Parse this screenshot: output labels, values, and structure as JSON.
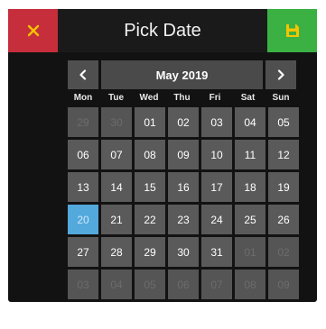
{
  "header": {
    "title": "Pick Date",
    "close_icon": "x-icon",
    "save_icon": "floppy-disk-icon",
    "close_color": "#c62e3c",
    "save_color": "#3bb043"
  },
  "nav": {
    "prev": "<",
    "next": ">",
    "month_label": "May 2019"
  },
  "weekdays": [
    "Mon",
    "Tue",
    "Wed",
    "Thu",
    "Fri",
    "Sat",
    "Sun"
  ],
  "days": [
    {
      "label": "29",
      "muted": true
    },
    {
      "label": "30",
      "muted": true
    },
    {
      "label": "01"
    },
    {
      "label": "02"
    },
    {
      "label": "03"
    },
    {
      "label": "04"
    },
    {
      "label": "05"
    },
    {
      "label": "06"
    },
    {
      "label": "07"
    },
    {
      "label": "08"
    },
    {
      "label": "09"
    },
    {
      "label": "10"
    },
    {
      "label": "11"
    },
    {
      "label": "12"
    },
    {
      "label": "13"
    },
    {
      "label": "14"
    },
    {
      "label": "15"
    },
    {
      "label": "16"
    },
    {
      "label": "17"
    },
    {
      "label": "18"
    },
    {
      "label": "19"
    },
    {
      "label": "20",
      "selected": true
    },
    {
      "label": "21"
    },
    {
      "label": "22"
    },
    {
      "label": "23"
    },
    {
      "label": "24"
    },
    {
      "label": "25"
    },
    {
      "label": "26"
    },
    {
      "label": "27"
    },
    {
      "label": "28"
    },
    {
      "label": "29"
    },
    {
      "label": "30"
    },
    {
      "label": "31"
    },
    {
      "label": "01",
      "muted": true
    },
    {
      "label": "02",
      "muted": true
    },
    {
      "label": "03",
      "muted": true
    },
    {
      "label": "04",
      "muted": true
    },
    {
      "label": "05",
      "muted": true
    },
    {
      "label": "06",
      "muted": true
    },
    {
      "label": "07",
      "muted": true
    },
    {
      "label": "08",
      "muted": true
    },
    {
      "label": "09",
      "muted": true
    }
  ],
  "selected_color": "#53a8dc"
}
